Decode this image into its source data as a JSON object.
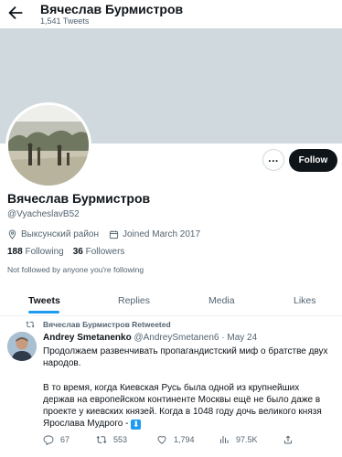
{
  "header": {
    "title": "Вячеслав Бурмистров",
    "subtitle": "1,541 Tweets"
  },
  "profile": {
    "name": "Вячеслав Бурмистров",
    "handle": "@VyacheslavB52",
    "location": "Выксунский район",
    "joined": "Joined March 2017",
    "following_count": "188",
    "following_label": "Following",
    "followers_count": "36",
    "followers_label": "Followers",
    "not_followed_text": "Not followed by anyone you're following",
    "follow_button": "Follow",
    "more_button": "..."
  },
  "tabs": [
    {
      "label": "Tweets",
      "active": true
    },
    {
      "label": "Replies",
      "active": false
    },
    {
      "label": "Media",
      "active": false
    },
    {
      "label": "Likes",
      "active": false
    }
  ],
  "tweet": {
    "retweet_text": "Вячеслав Бурмистров Retweeted",
    "author_name": "Andrey Smetanenko",
    "author_handle": "@AndreySmetanen6",
    "separator": "·",
    "date": "May 24",
    "paragraph1": "Продолжаем развенчивать пропагандистский миф о братстве двух народов.",
    "paragraph2": "В то время, когда Киевская Русь была одной из крупнейших держав на европейском континенте Москвы ещё не было даже в проекте у киевских князей. Когда в 1048 году дочь великого князя Ярослава Мудрого -",
    "emoji": "⬇",
    "replies": "67",
    "retweets": "553",
    "likes": "1,794",
    "views": "97.5K"
  },
  "colors": {
    "accent": "#1d9bf0",
    "text": "#0f1419",
    "muted": "#536471",
    "banner": "#cfd9de"
  }
}
